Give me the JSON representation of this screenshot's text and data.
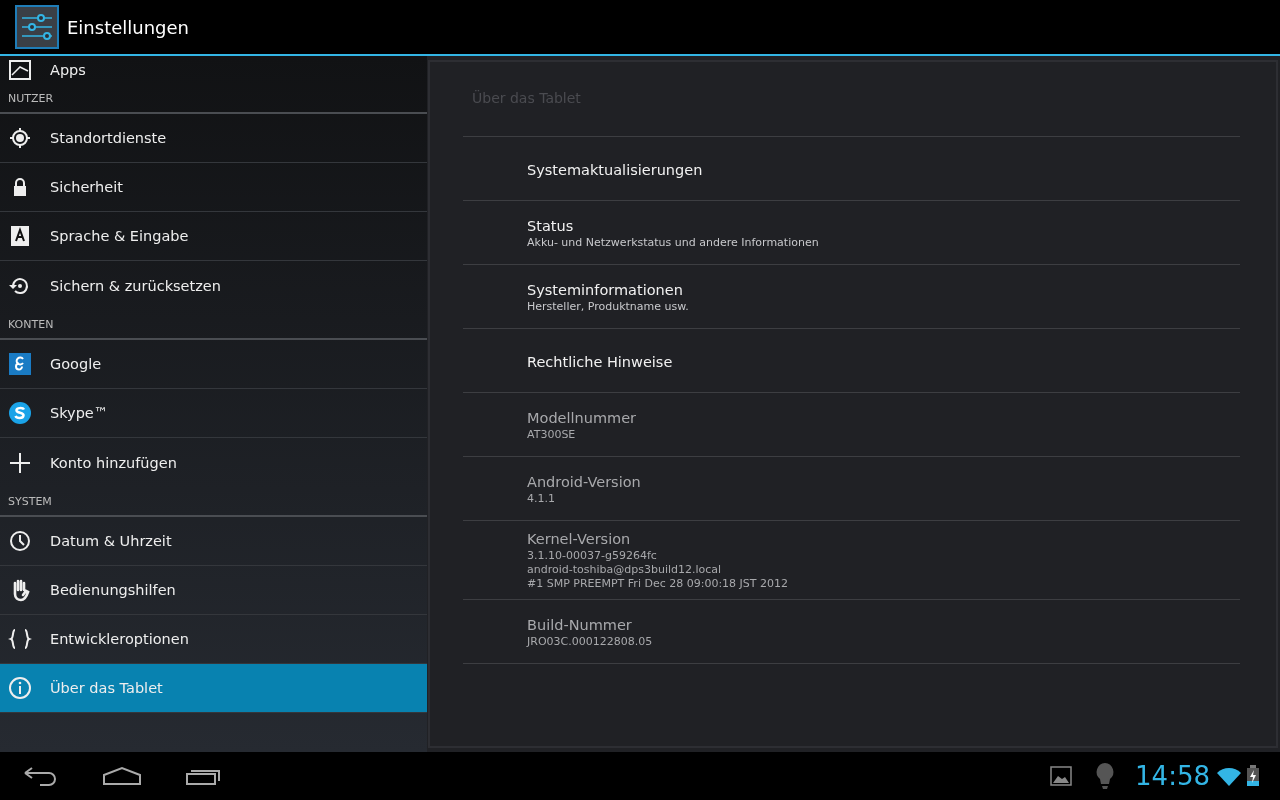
{
  "action_bar": {
    "title": "Einstellungen"
  },
  "sidebar": {
    "entries": [
      {
        "kind": "item",
        "label": "Apps",
        "selected": false
      },
      {
        "kind": "header",
        "label": "NUTZER"
      },
      {
        "kind": "item",
        "label": "Standortdienste",
        "selected": false
      },
      {
        "kind": "item",
        "label": "Sicherheit",
        "selected": false
      },
      {
        "kind": "item",
        "label": "Sprache & Eingabe",
        "selected": false
      },
      {
        "kind": "item",
        "label": "Sichern & zurücksetzen",
        "selected": false
      },
      {
        "kind": "header",
        "label": "KONTEN"
      },
      {
        "kind": "item",
        "label": "Google",
        "selected": false
      },
      {
        "kind": "item",
        "label": "Skype™",
        "selected": false
      },
      {
        "kind": "item",
        "label": "Konto hinzufügen",
        "selected": false
      },
      {
        "kind": "header",
        "label": "SYSTEM"
      },
      {
        "kind": "item",
        "label": "Datum & Uhrzeit",
        "selected": false
      },
      {
        "kind": "item",
        "label": "Bedienungshilfen",
        "selected": false
      },
      {
        "kind": "item",
        "label": "Entwickleroptionen",
        "selected": false
      },
      {
        "kind": "item",
        "label": "Über das Tablet",
        "selected": true
      }
    ]
  },
  "detail": {
    "title": "Über das Tablet",
    "rows": [
      {
        "kind": "link",
        "title": "Systemaktualisierungen"
      },
      {
        "kind": "link",
        "title": "Status",
        "summary": "Akku- und Netzwerkstatus und andere Informationen"
      },
      {
        "kind": "link",
        "title": "Systeminformationen",
        "summary": "Hersteller, Produktname usw."
      },
      {
        "kind": "link",
        "title": "Rechtliche Hinweise"
      },
      {
        "kind": "info",
        "title": "Modellnummer",
        "summary": "AT300SE"
      },
      {
        "kind": "info",
        "title": "Android-Version",
        "summary": "4.1.1"
      },
      {
        "kind": "info",
        "title": "Kernel-Version",
        "summary": "3.1.10-00037-g59264fc\nandroid-toshiba@dps3build12.local\n#1 SMP PREEMPT Fri Dec 28 09:00:18 JST 2012"
      },
      {
        "kind": "info",
        "title": "Build-Nummer",
        "summary": "JRO03C.000122808.05"
      }
    ]
  },
  "system_bar": {
    "time": "14:58"
  }
}
